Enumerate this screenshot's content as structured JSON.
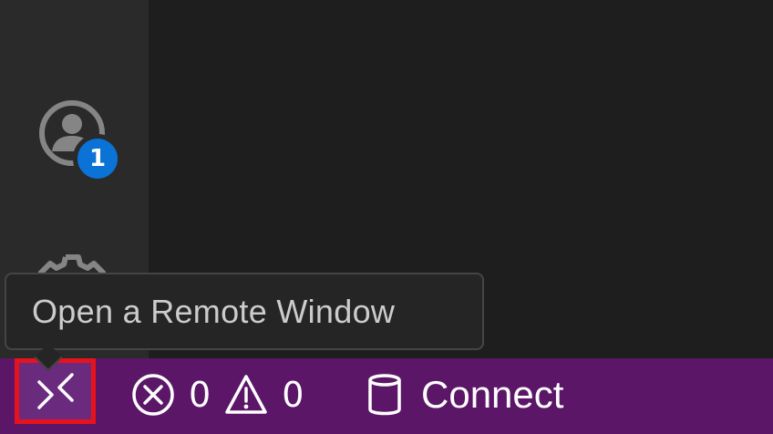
{
  "activity_bar": {
    "accounts": {
      "icon": "account-icon",
      "badge_count": "1"
    },
    "manage": {
      "icon": "gear-icon"
    }
  },
  "tooltip": {
    "text": "Open a Remote Window"
  },
  "status_bar": {
    "remote": {
      "icon": "remote-icon"
    },
    "errors": {
      "icon": "error-icon",
      "count": "0"
    },
    "warnings": {
      "icon": "warning-icon",
      "count": "0"
    },
    "connect": {
      "icon": "database-icon",
      "label": "Connect"
    }
  },
  "colors": {
    "status_bar_bg": "#5b1668",
    "badge_bg": "#0b72d6",
    "highlight_border": "#e8121c"
  }
}
